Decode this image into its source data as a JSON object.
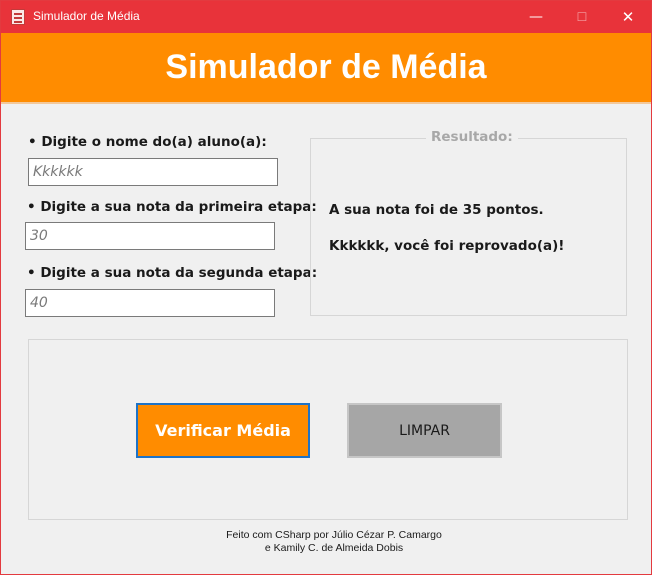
{
  "window": {
    "title": "Simulador de Média",
    "controls": {
      "minimize": "—",
      "maximize": "☐",
      "close": "✕"
    }
  },
  "header": {
    "title": "Simulador de Média"
  },
  "form": {
    "name_label": "• Digite o nome do(a) aluno(a):",
    "name_value": "Kkkkkk",
    "grade1_label": "• Digite a sua nota da primeira etapa:",
    "grade1_value": "30",
    "grade2_label": "• Digite a sua nota da segunda etapa:",
    "grade2_value": "40"
  },
  "result": {
    "legend": "Resultado:",
    "line1": "A sua nota foi de 35 pontos.",
    "line2": "Kkkkkk, você foi reprovado(a)!"
  },
  "actions": {
    "verify_label": "Verificar Média",
    "clear_label": "LIMPAR"
  },
  "footer": {
    "line1": "Feito com CSharp por Júlio Cézar P. Camargo",
    "line2": "e Kamily C. de Almeida Dobis"
  },
  "colors": {
    "titlebar": "#e8333a",
    "header": "#ff8c00",
    "verify_button": "#ff8c00",
    "clear_button": "#a6a6a6"
  }
}
